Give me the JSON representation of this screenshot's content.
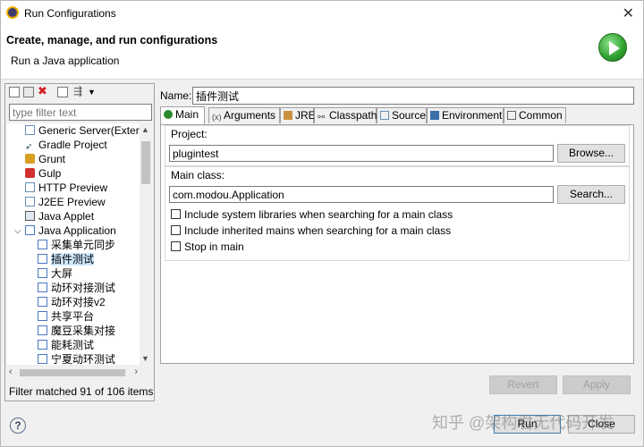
{
  "window": {
    "title": "Run Configurations"
  },
  "header": {
    "title": "Create, manage, and run configurations",
    "subtitle": "Run a Java application"
  },
  "left": {
    "filter_placeholder": "type filter text",
    "tree": [
      {
        "label": "Generic Server(Extern",
        "icon": "server-icon"
      },
      {
        "label": "Gradle Project",
        "icon": "gradle-icon"
      },
      {
        "label": "Grunt",
        "icon": "grunt-icon"
      },
      {
        "label": "Gulp",
        "icon": "gulp-icon"
      },
      {
        "label": "HTTP Preview",
        "icon": "page-icon"
      },
      {
        "label": "J2EE Preview",
        "icon": "page-icon"
      },
      {
        "label": "Java Applet",
        "icon": "applet-icon"
      },
      {
        "label": "Java Application",
        "icon": "java-app-icon",
        "expanded": true
      },
      {
        "label": "采集单元同步",
        "icon": "java-launch-icon"
      },
      {
        "label": "插件测试",
        "icon": "java-launch-icon",
        "selected": true
      },
      {
        "label": "大屏",
        "icon": "java-launch-icon"
      },
      {
        "label": "动环对接测试",
        "icon": "java-launch-icon"
      },
      {
        "label": "动环对接v2",
        "icon": "java-launch-icon"
      },
      {
        "label": "共享平台",
        "icon": "java-launch-icon"
      },
      {
        "label": "魔豆采集对接",
        "icon": "java-launch-icon"
      },
      {
        "label": "能耗测试",
        "icon": "java-launch-icon"
      },
      {
        "label": "宁夏动环测试",
        "icon": "java-launch-icon"
      }
    ],
    "filter_status": "Filter matched 91 of 106 items"
  },
  "right": {
    "name_label": "Name:",
    "name_value": "插件测试",
    "tabs": [
      "Main",
      "Arguments",
      "JRE",
      "Classpath",
      "Source",
      "Environment",
      "Common"
    ],
    "project_label": "Project:",
    "project_value": "plugintest",
    "browse_label": "Browse...",
    "main_class_label": "Main class:",
    "main_class_value": "com.modou.Application",
    "search_label": "Search...",
    "checks": [
      "Include system libraries when searching for a main class",
      "Include inherited mains when searching for a main class",
      "Stop in main"
    ],
    "revert_label": "Revert",
    "apply_label": "Apply"
  },
  "footer": {
    "run_label": "Run",
    "close_label": "Close",
    "watermark": "知乎 @架构君无代码开发"
  }
}
